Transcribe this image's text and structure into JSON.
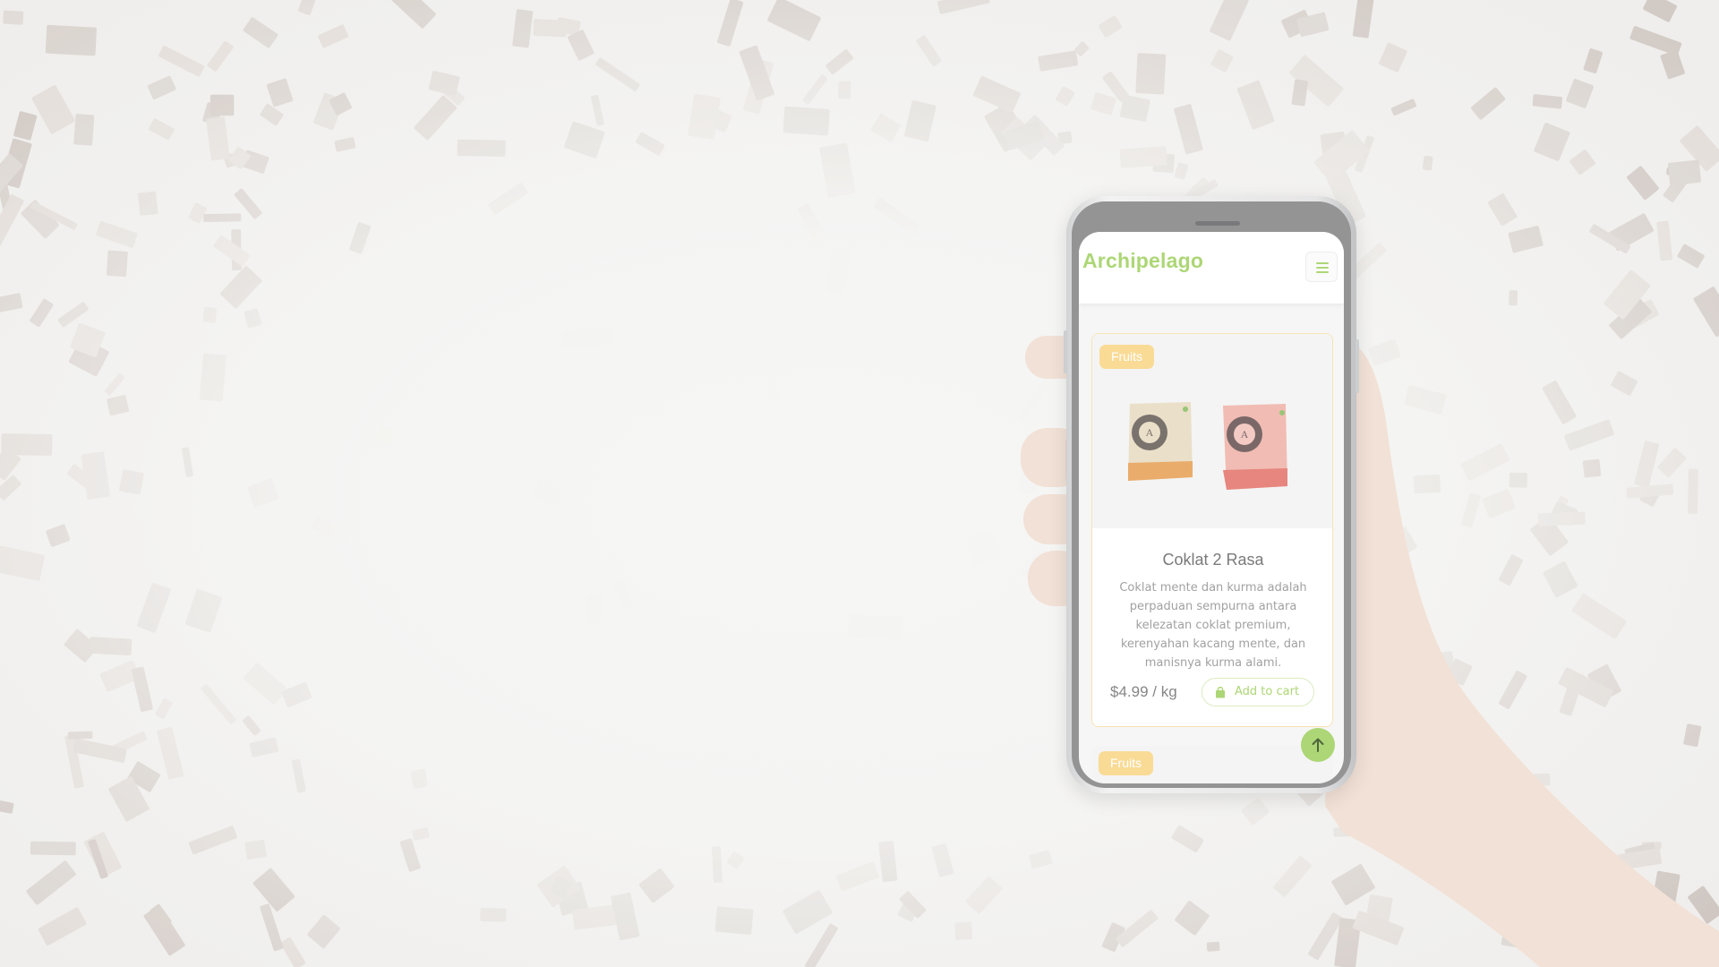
{
  "navbar": {
    "brand": "Archipelago",
    "menu_icon": "hamburger-icon"
  },
  "colors": {
    "brand_green": "#a6d36b",
    "badge_orange": "#f9d88e",
    "card_border": "#f7e1b0"
  },
  "products": [
    {
      "category": "Fruits",
      "title": "Coklat 2 Rasa",
      "description": "Coklat mente dan kurma adalah perpaduan sempurna antara kelezatan coklat premium, kerenyahan kacang mente, dan manisnya kurma alami.",
      "price": "$4.99 / kg",
      "cart_label": "Add to cart",
      "cart_icon": "shopping-bag-icon"
    },
    {
      "category": "Fruits"
    }
  ],
  "back_to_top_icon": "arrow-up-icon"
}
